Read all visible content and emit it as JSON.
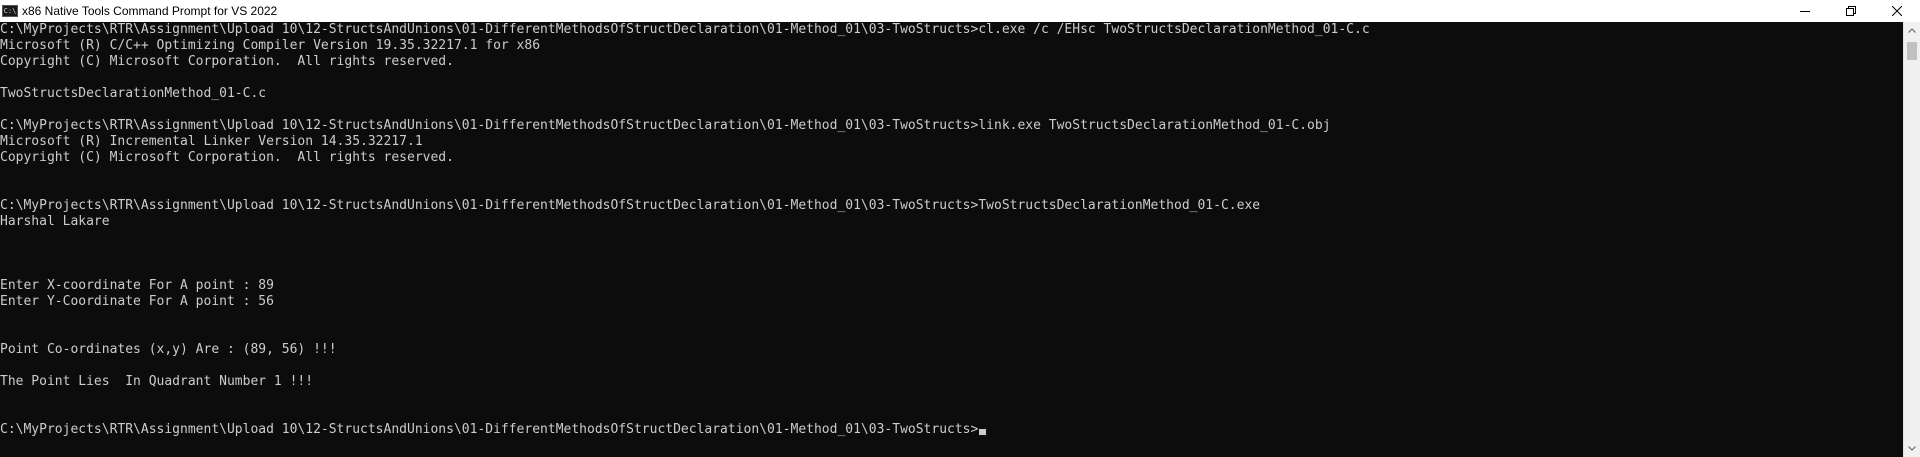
{
  "window": {
    "title": "x86 Native Tools Command Prompt for VS 2022",
    "app_icon_text": "C:\\",
    "controls": [
      "minimize-icon",
      "restore-icon",
      "close-icon"
    ]
  },
  "console": {
    "lines": [
      "C:\\MyProjects\\RTR\\Assignment\\Upload 10\\12-StructsAndUnions\\01-DifferentMethodsOfStructDeclaration\\01-Method_01\\03-TwoStructs>cl.exe /c /EHsc TwoStructsDeclarationMethod_01-C.c",
      "Microsoft (R) C/C++ Optimizing Compiler Version 19.35.32217.1 for x86",
      "Copyright (C) Microsoft Corporation.  All rights reserved.",
      "",
      "TwoStructsDeclarationMethod_01-C.c",
      "",
      "C:\\MyProjects\\RTR\\Assignment\\Upload 10\\12-StructsAndUnions\\01-DifferentMethodsOfStructDeclaration\\01-Method_01\\03-TwoStructs>link.exe TwoStructsDeclarationMethod_01-C.obj",
      "Microsoft (R) Incremental Linker Version 14.35.32217.1",
      "Copyright (C) Microsoft Corporation.  All rights reserved.",
      "",
      "",
      "C:\\MyProjects\\RTR\\Assignment\\Upload 10\\12-StructsAndUnions\\01-DifferentMethodsOfStructDeclaration\\01-Method_01\\03-TwoStructs>TwoStructsDeclarationMethod_01-C.exe",
      "Harshal Lakare",
      "",
      "",
      "",
      "Enter X-coordinate For A point : 89",
      "Enter Y-Coordinate For A point : 56",
      "",
      "",
      "Point Co-ordinates (x,y) Are : (89, 56) !!!",
      "",
      "The Point Lies  In Quadrant Number 1 !!!",
      "",
      "",
      "C:\\MyProjects\\RTR\\Assignment\\Upload 10\\12-StructsAndUnions\\01-DifferentMethodsOfStructDeclaration\\01-Method_01\\03-TwoStructs>"
    ]
  },
  "colors": {
    "background": "#0c0c0c",
    "foreground": "#cccccc",
    "titlebar": "#ffffff"
  }
}
